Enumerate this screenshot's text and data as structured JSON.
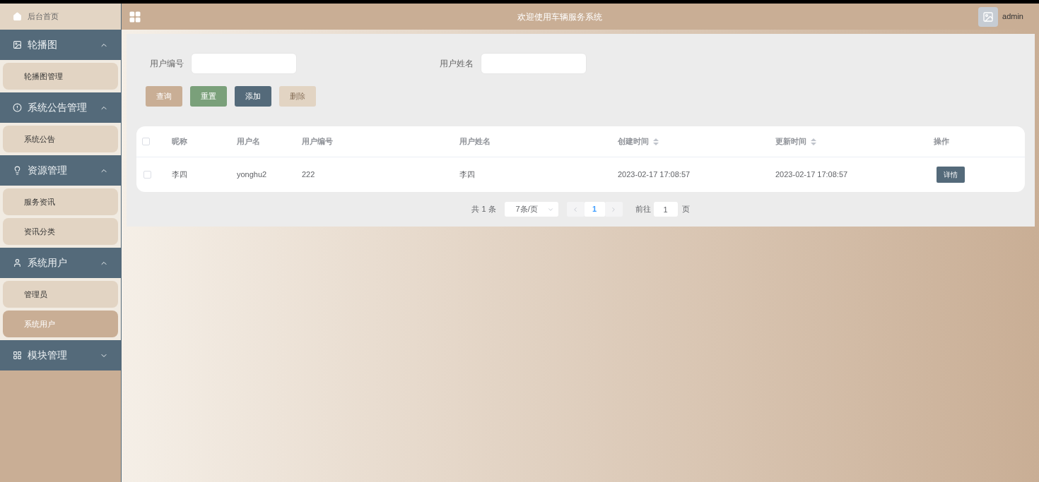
{
  "sidebar": {
    "home": {
      "label": "后台首页"
    },
    "groups": [
      {
        "label": "轮播图",
        "expanded": true,
        "items": [
          {
            "label": "轮播图管理",
            "selected": false
          }
        ]
      },
      {
        "label": "系统公告管理",
        "expanded": true,
        "items": [
          {
            "label": "系统公告",
            "selected": false
          }
        ]
      },
      {
        "label": "资源管理",
        "expanded": true,
        "items": [
          {
            "label": "服务资讯",
            "selected": false
          },
          {
            "label": "资讯分类",
            "selected": false
          }
        ]
      },
      {
        "label": "系统用户",
        "expanded": true,
        "items": [
          {
            "label": "管理员",
            "selected": false
          },
          {
            "label": "系统用户",
            "selected": true
          }
        ]
      },
      {
        "label": "模块管理",
        "expanded": false
      }
    ]
  },
  "header": {
    "title": "欢迎使用车辆服务系统",
    "user": "admin"
  },
  "search": {
    "fields": [
      {
        "label": "用户编号"
      },
      {
        "label": "用户姓名"
      }
    ],
    "buttons": [
      {
        "label": "查询",
        "kind": "query"
      },
      {
        "label": "重置",
        "kind": "reset"
      },
      {
        "label": "添加",
        "kind": "add"
      },
      {
        "label": "删除",
        "kind": "delete"
      }
    ]
  },
  "table": {
    "select_all_checked": false,
    "columns": [
      {
        "label": "昵称",
        "sortable": false
      },
      {
        "label": "用户名",
        "sortable": false
      },
      {
        "label": "用户编号",
        "sortable": false
      },
      {
        "label": "用户姓名",
        "sortable": false
      },
      {
        "label": "创建时间",
        "sortable": true
      },
      {
        "label": "更新时间",
        "sortable": true
      },
      {
        "label": "操作",
        "sortable": false
      }
    ],
    "rows": [
      {
        "checked": false,
        "cells": [
          "李四",
          "yonghu2",
          "222",
          "李四",
          "2023-02-17 17:08:57",
          "2023-02-17 17:08:57"
        ],
        "action": "详情"
      }
    ]
  },
  "pagination": {
    "total": "共 1 条",
    "page_size": "7条/页",
    "pages": [
      {
        "label": "1",
        "selected": true
      }
    ],
    "goto_label": "前往",
    "goto_value": "1",
    "goto_suffix": "页"
  }
}
